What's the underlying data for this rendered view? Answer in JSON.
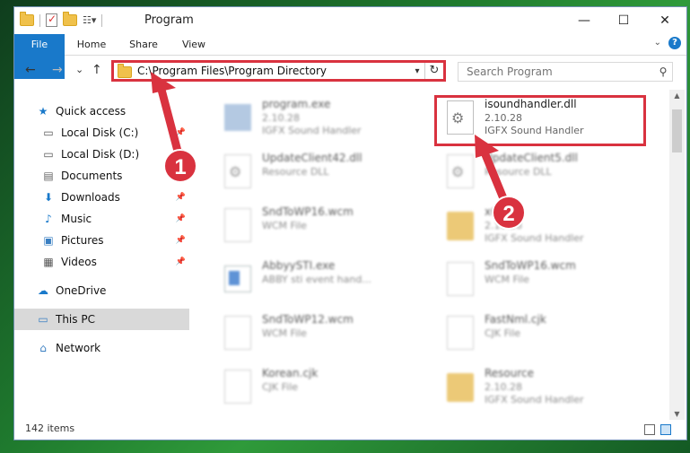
{
  "window": {
    "title": "Program",
    "controls": {
      "minimize": "—",
      "maximize": "☐",
      "close": "✕"
    }
  },
  "ribbon": {
    "tabs": [
      "File",
      "Home",
      "Share",
      "View"
    ],
    "help": "?"
  },
  "nav": {
    "back": "←",
    "forward": "→",
    "recent": "⌄",
    "up": "↑",
    "address": "C:\\Program Files\\Program Directory",
    "refresh": "↻",
    "search_placeholder": "Search Program"
  },
  "sidebar": {
    "items": [
      {
        "label": "Quick access",
        "icon": "star-icon",
        "glyph": "★",
        "color": "#1979ca"
      },
      {
        "label": "Local Disk (C:)",
        "icon": "drive-icon",
        "glyph": "▭",
        "color": "#555",
        "pinned": true
      },
      {
        "label": "Local Disk (D:)",
        "icon": "drive-icon",
        "glyph": "▭",
        "color": "#555",
        "pinned": true
      },
      {
        "label": "Documents",
        "icon": "document-icon",
        "glyph": "▤",
        "color": "#666",
        "pinned": true
      },
      {
        "label": "Downloads",
        "icon": "download-icon",
        "glyph": "⬇",
        "color": "#1979ca",
        "pinned": true
      },
      {
        "label": "Music",
        "icon": "music-icon",
        "glyph": "♪",
        "color": "#1979ca",
        "pinned": true
      },
      {
        "label": "Pictures",
        "icon": "pictures-icon",
        "glyph": "▣",
        "color": "#3a7fc2",
        "pinned": true
      },
      {
        "label": "Videos",
        "icon": "video-icon",
        "glyph": "▦",
        "color": "#555",
        "pinned": true
      },
      {
        "label": "OneDrive",
        "icon": "cloud-icon",
        "glyph": "☁",
        "color": "#1979ca"
      },
      {
        "label": "This PC",
        "icon": "computer-icon",
        "glyph": "▭",
        "color": "#3a7fc2",
        "selected": true
      },
      {
        "label": "Network",
        "icon": "network-icon",
        "glyph": "⌂",
        "color": "#3a7fc2"
      }
    ]
  },
  "files": [
    {
      "name": "program.exe",
      "version": "2.10.28",
      "desc": "IGFX Sound Handler",
      "kind": "exe"
    },
    {
      "name": "isoundhandler.dll",
      "version": "2.10.28",
      "desc": "IGFX Sound Handler",
      "kind": "dll"
    },
    {
      "name": "UpdateClient42.dll",
      "version": "",
      "desc": "Resource DLL",
      "kind": "dll"
    },
    {
      "name": "UpdateClient5.dll",
      "version": "",
      "desc": "Resource DLL",
      "kind": "dll"
    },
    {
      "name": "SndToWP16.wcm",
      "version": "",
      "desc": "WCM File",
      "kind": "doc"
    },
    {
      "name": "x64",
      "version": "2.10.28",
      "desc": "IGFX Sound Handler",
      "kind": "folder"
    },
    {
      "name": "AbbyySTI.exe",
      "version": "",
      "desc": "ABBY sti event hand...",
      "kind": "exe2"
    },
    {
      "name": "SndToWP16.wcm",
      "version": "",
      "desc": "WCM File",
      "kind": "doc"
    },
    {
      "name": "SndToWP12.wcm",
      "version": "",
      "desc": "WCM File",
      "kind": "doc"
    },
    {
      "name": "FastNml.cjk",
      "version": "",
      "desc": "CJK File",
      "kind": "doc"
    },
    {
      "name": "Korean.cjk",
      "version": "",
      "desc": "CJK File",
      "kind": "doc"
    },
    {
      "name": "Resource",
      "version": "2.10.28",
      "desc": "IGFX Sound Handler",
      "kind": "folder"
    }
  ],
  "status": {
    "count": "142 items"
  },
  "callouts": [
    "1",
    "2"
  ],
  "colors": {
    "accent": "#1979ca",
    "highlight": "#d9323f",
    "selected": "#d9d9d9"
  }
}
